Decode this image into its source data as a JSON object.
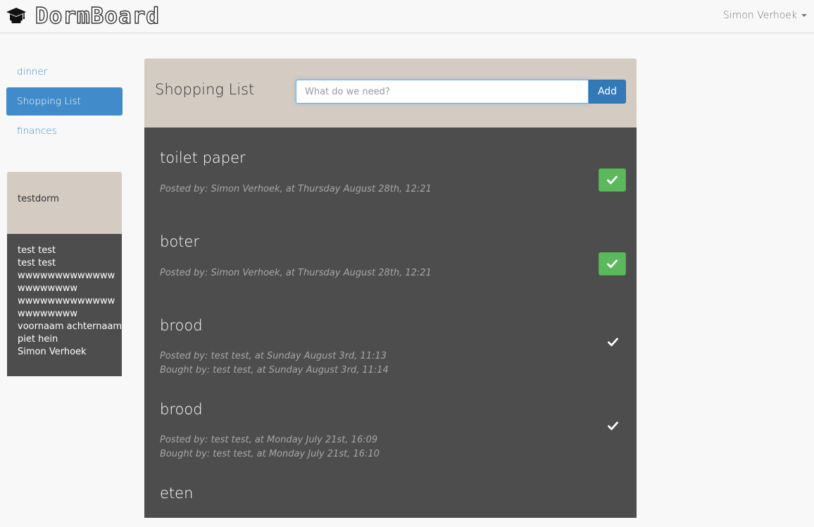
{
  "navbar": {
    "brand": "DormBoard",
    "brand_icon": "graduation-cap-icon",
    "user_name": "Simon Verhoek"
  },
  "sidebar": {
    "items": [
      {
        "label": "dinner",
        "active": false
      },
      {
        "label": "Shopping List",
        "active": true
      },
      {
        "label": "finances",
        "active": false
      }
    ]
  },
  "dorm": {
    "name": "testdorm",
    "members": [
      "test test",
      "test test",
      "wwwwwwwwwwwww",
      "wwwwwwww",
      "wwwwwwwwwwwww",
      "wwwwwwww",
      "voornaam achternaam",
      "piet hein",
      "Simon Verhoek"
    ]
  },
  "main": {
    "title": "Shopping List",
    "input_placeholder": "What do we need?",
    "add_label": "Add",
    "items": [
      {
        "name": "toilet paper",
        "posted": "Posted by: Simon Verhoek, at Thursday August 28th, 12:21",
        "bought": "",
        "status": "open"
      },
      {
        "name": "boter",
        "posted": "Posted by: Simon Verhoek, at Thursday August 28th, 12:21",
        "bought": "",
        "status": "open"
      },
      {
        "name": "brood",
        "posted": "Posted by: test test, at Sunday August 3rd, 11:13",
        "bought": "Bought by: test test, at Sunday August 3rd, 11:14",
        "status": "bought"
      },
      {
        "name": "brood",
        "posted": "Posted by: test test, at Monday July 21st, 16:09",
        "bought": "Bought by: test test, at Monday July 21st, 16:10",
        "status": "bought"
      },
      {
        "name": "eten",
        "posted": "",
        "bought": "",
        "status": "unknown"
      }
    ]
  },
  "colors": {
    "accent": "#428bca",
    "panel_header": "#d4cbc3",
    "panel_body": "#4d4d4d",
    "success": "#5cb85c"
  }
}
